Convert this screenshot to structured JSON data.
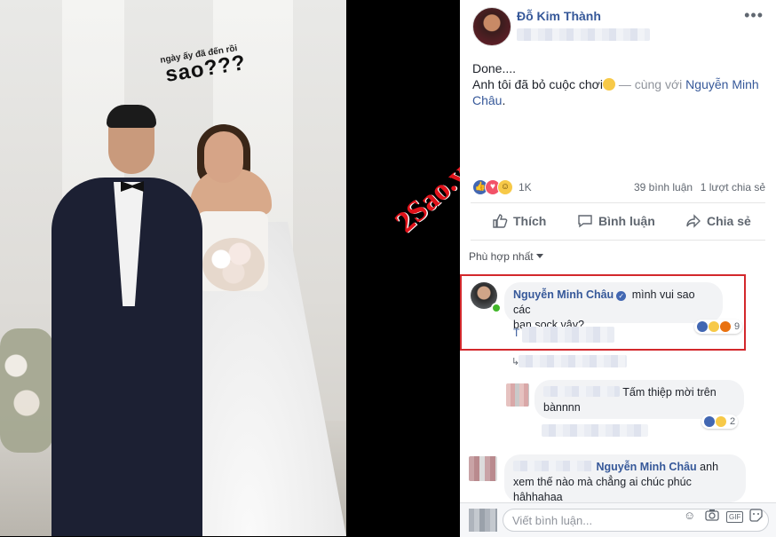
{
  "photo": {
    "caption_small": "ngày ấy đã đến rồi",
    "caption_big": "sao???",
    "watermark": "2Sao.vn"
  },
  "post": {
    "author": "Đỗ Kim Thành",
    "text_line1": "Done....",
    "text_line2": "Anh tôi đã bỏ cuộc chơi",
    "with_prefix": "— cùng với",
    "tagged": "Nguyễn Minh Châu",
    "period": "."
  },
  "stats": {
    "reactions": "1K",
    "comments": "39 bình luận",
    "shares": "1 lượt chia sẻ"
  },
  "actions": {
    "like": "Thích",
    "comment": "Bình luận",
    "share": "Chia sẻ"
  },
  "sort_label": "Phù hợp nhất",
  "comments": [
    {
      "name": "Nguyễn Minh Châu",
      "text_a": "mình vui sao các",
      "text_b": "bạn sock vậy?",
      "reply_initial": "T",
      "reactions": "9"
    },
    {
      "text_a": "Tấm thiệp mời trên",
      "text_b": "bànnnn",
      "reactions": "2"
    },
    {
      "mention": "Nguyễn Minh Châu",
      "text_a": "anh",
      "text_b": "xem thế nào mà chẳng ai chúc phúc",
      "text_c": "hâhhahaa"
    }
  ],
  "composer": {
    "placeholder": "Viết bình luận..."
  },
  "colors": {
    "link": "#365899",
    "highlight": "#d3282c",
    "watermark": "#e0121a"
  }
}
